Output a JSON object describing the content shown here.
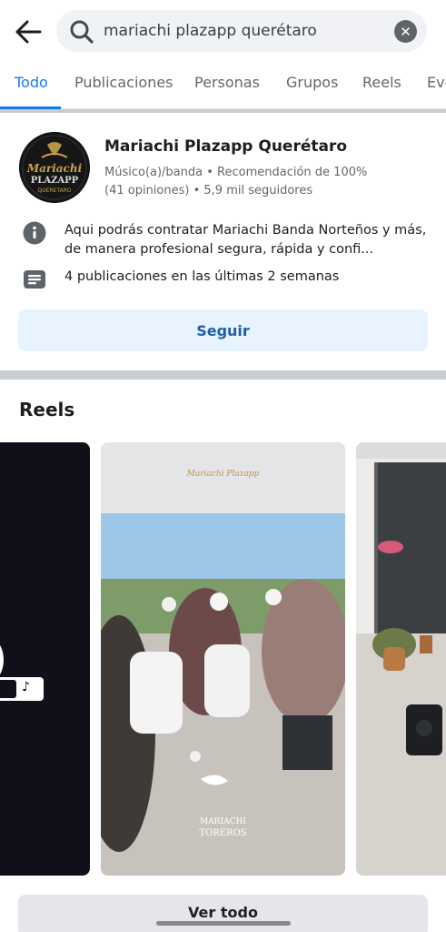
{
  "search": {
    "query": "mariachi plazapp querétaro"
  },
  "tabs": [
    {
      "label": "Todo"
    },
    {
      "label": "Publicaciones"
    },
    {
      "label": "Personas"
    },
    {
      "label": "Grupos"
    },
    {
      "label": "Reels"
    },
    {
      "label": "Eve"
    }
  ],
  "page": {
    "name": "Mariachi Plazapp Querétaro",
    "meta_line1": "Músico(a)/banda • Recomendación de 100%",
    "meta_line2": "(41 opiniones) • 5,9 mil seguidores",
    "description": "Aqui podrás contratar Mariachi Banda Norteños y más, de manera profesional segura, rápida y confi...",
    "posts_info": "4 publicaciones en las últimas 2 semanas",
    "follow_label": "Seguir",
    "avatar_text": {
      "line1": "Mariachi",
      "line2": "PLAZAPP",
      "line3": "QUERETARO"
    }
  },
  "reels": {
    "title": "Reels",
    "main_watermark_top": "Mariachi Plazapp",
    "main_watermark_bottom_1": "MARIACHI",
    "main_watermark_bottom_2": "TOREROS"
  },
  "see_all_label": "Ver todo",
  "colors": {
    "accent": "#1877f2",
    "follow_bg": "#e7f3ff",
    "follow_text": "#1f5fa7"
  }
}
